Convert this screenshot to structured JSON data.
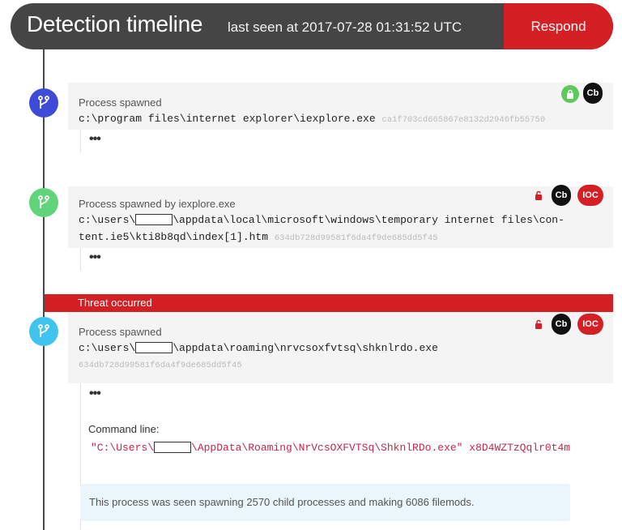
{
  "header": {
    "title": "Detection timeline",
    "subtitle": "last seen at 2017-07-28 01:31:52 UTC",
    "respond_label": "Respond"
  },
  "colors": {
    "node1": "#3e4ad8",
    "node2": "#5fd47a",
    "node3": "#3fc4ef",
    "threat": "#d41f24"
  },
  "events": [
    {
      "label": "Process spawned",
      "path": "c:\\program files\\internet explorer\\iexplore.exe",
      "hash": "ca1f703cd665867e8132d2946fb55750",
      "more": "•••",
      "badges": [
        "lock-closed-icon",
        "Cb"
      ]
    },
    {
      "label": "Process spawned by iexplore.exe",
      "path_line1_pre": "c:\\users\\",
      "path_line1_post": "\\appdata\\local\\microsoft\\windows\\temporary internet files\\con-",
      "path_line2": "tent.ie5\\kti8b8qd\\index[1].htm",
      "hash": "634db728d99581f6da4f9de685dd5f45",
      "more": "•••",
      "badges": [
        "lock-open-icon",
        "Cb",
        "IOC"
      ]
    },
    {
      "threat_label": "Threat occurred",
      "label": "Process spawned",
      "path_pre": "c:\\users\\",
      "path_post": "\\appdata\\roaming\\nrvcsoxfvtsq\\shknlrdo.exe",
      "hash": "634db728d99581f6da4f9de685dd5f45",
      "more": "•••",
      "badges": [
        "lock-open-icon",
        "Cb",
        "IOC"
      ],
      "command_label": "Command line:",
      "command_pre": "\"C:\\Users\\",
      "command_post": "\\AppData\\Roaming\\NrVcsOXFVTSq\\ShknlRDo.exe\" x8D4WZTzQqlr0t4m",
      "info": "This process was seen spawning 2570 child processes and making 6086 filemods."
    }
  ]
}
